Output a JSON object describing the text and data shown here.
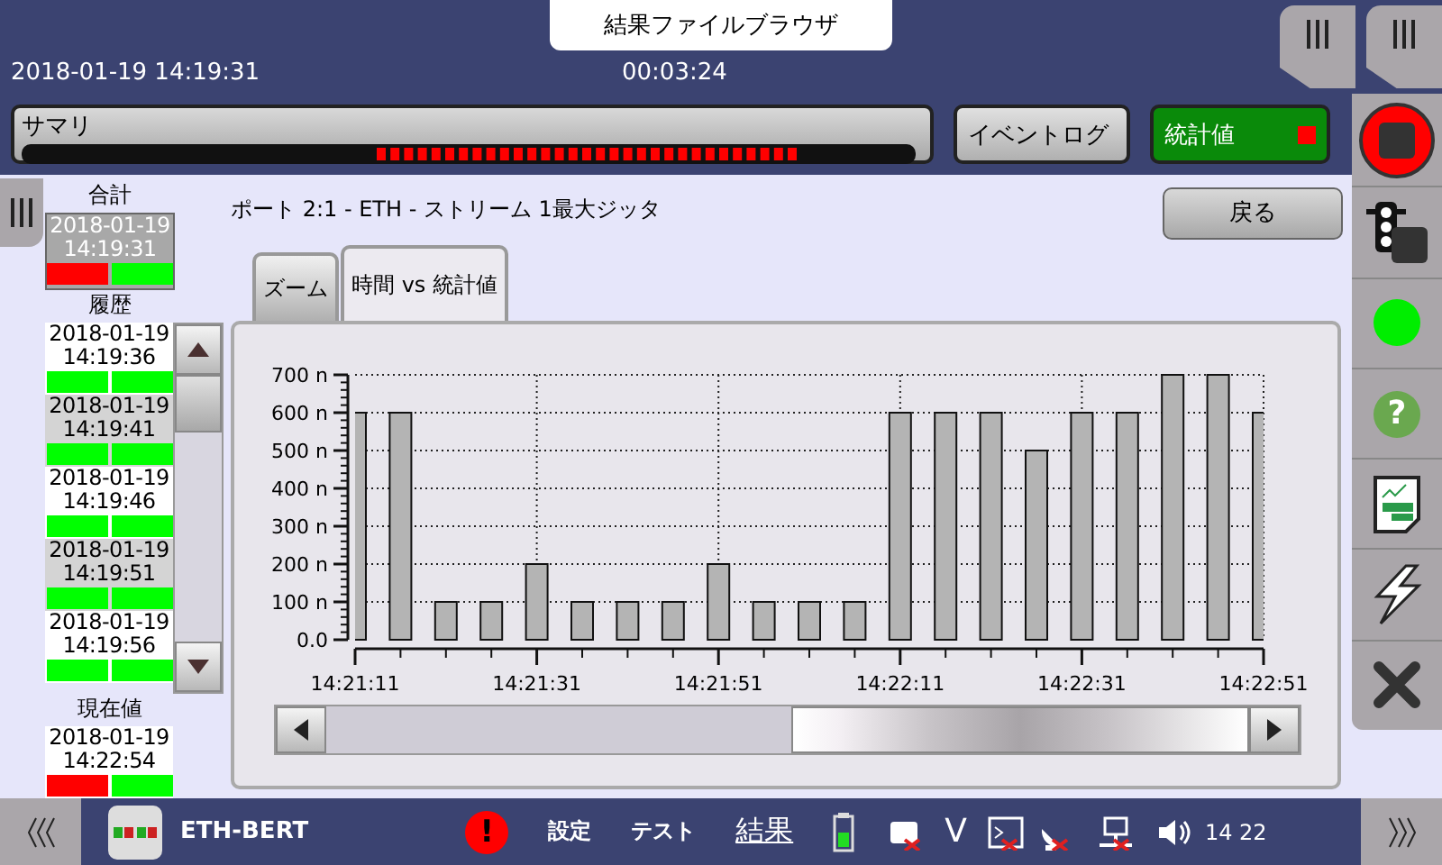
{
  "header": {
    "title": "結果ファイルブラウザ",
    "datetime": "2018-01-19 14:19:31",
    "elapsed": "00:03:24"
  },
  "toolbar": {
    "summary_label": "サマリ",
    "buttons": [
      {
        "label": "イベントログ",
        "selected": false,
        "alarm": false
      },
      {
        "label": "統計値",
        "selected": true,
        "alarm": true
      }
    ]
  },
  "left_panel": {
    "total_heading": "合計",
    "total": {
      "date": "2018-01-19",
      "time": "14:19:31",
      "selected": true,
      "status": [
        {
          "color": "#ff0000"
        },
        {
          "color": "#00ff00"
        }
      ]
    },
    "history_heading": "履歴",
    "history": [
      {
        "date": "2018-01-19",
        "time": "14:19:36",
        "selected": false,
        "status": [
          {
            "color": "#00ff00"
          },
          {
            "color": "#00ff00"
          }
        ]
      },
      {
        "date": "2018-01-19",
        "time": "14:19:41",
        "selected": false,
        "status": [
          {
            "color": "#00ff00"
          },
          {
            "color": "#00ff00"
          }
        ]
      },
      {
        "date": "2018-01-19",
        "time": "14:19:46",
        "selected": false,
        "status": [
          {
            "color": "#00ff00"
          },
          {
            "color": "#00ff00"
          }
        ]
      },
      {
        "date": "2018-01-19",
        "time": "14:19:51",
        "selected": false,
        "status": [
          {
            "color": "#00ff00"
          },
          {
            "color": "#00ff00"
          }
        ]
      },
      {
        "date": "2018-01-19",
        "time": "14:19:56",
        "selected": false,
        "status": [
          {
            "color": "#00ff00"
          },
          {
            "color": "#00ff00"
          }
        ]
      }
    ],
    "current_heading": "現在値",
    "current": {
      "date": "2018-01-19",
      "time": "14:22:54",
      "selected": false,
      "status": [
        {
          "color": "#ff0000"
        },
        {
          "color": "#00ff00"
        }
      ]
    }
  },
  "content": {
    "title": "ポート 2:1 - ETH - ストリーム 1最大ジッタ",
    "back_button": "戻る",
    "tabs": [
      {
        "label": "ズーム",
        "selected": false
      },
      {
        "label": "時間 vs 統計値",
        "selected": true
      }
    ],
    "chart_data": {
      "type": "bar",
      "categories": [
        "14:21:11",
        null,
        null,
        null,
        "14:21:31",
        null,
        null,
        null,
        "14:21:51",
        null,
        null,
        null,
        "14:22:11",
        null,
        null,
        null,
        "14:22:31",
        null,
        null,
        null,
        "14:22:51"
      ],
      "values": [
        600,
        600,
        100,
        100,
        200,
        100,
        100,
        100,
        200,
        100,
        100,
        100,
        600,
        600,
        600,
        500,
        600,
        600,
        700,
        700,
        600
      ],
      "ylim": [
        0,
        700
      ],
      "grid": true,
      "yticks": [
        {
          "value": 0,
          "label": "0.0"
        },
        {
          "value": 100,
          "label": "100 n"
        },
        {
          "value": 200,
          "label": "200 n"
        },
        {
          "value": 300,
          "label": "300 n"
        },
        {
          "value": 400,
          "label": "400 n"
        },
        {
          "value": 500,
          "label": "500 n"
        },
        {
          "value": 600,
          "label": "600 n"
        },
        {
          "value": 700,
          "label": "700 n"
        }
      ]
    }
  },
  "sidebar": {
    "help_label": "?"
  },
  "footer": {
    "app_name": "ETH-BERT",
    "alert_label": "!",
    "nav": [
      {
        "label": "設定",
        "selected": false
      },
      {
        "label": "テスト",
        "selected": false
      },
      {
        "label": "結果",
        "selected": true
      }
    ],
    "v_label": "V",
    "clock": "14 22"
  }
}
